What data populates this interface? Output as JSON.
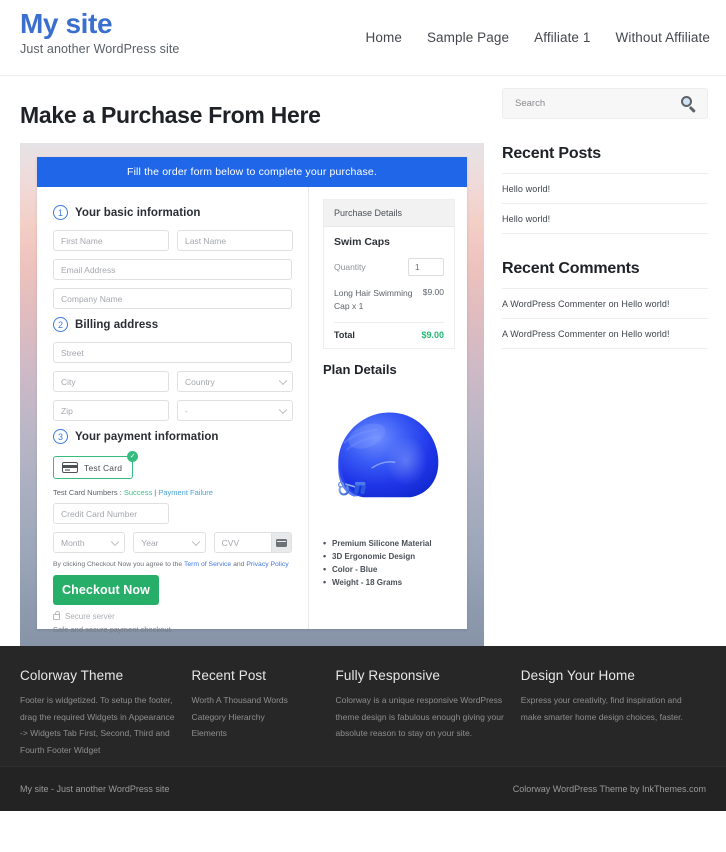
{
  "header": {
    "site_title": "My site",
    "tagline": "Just another WordPress site",
    "nav": [
      {
        "label": "Home"
      },
      {
        "label": "Sample Page"
      },
      {
        "label": "Affiliate 1"
      },
      {
        "label": "Without Affiliate"
      }
    ]
  },
  "main": {
    "page_title": "Make a Purchase From Here",
    "form": {
      "banner": "Fill the order form below to complete your purchase.",
      "steps": [
        {
          "num": "1",
          "label": "Your basic information"
        },
        {
          "num": "2",
          "label": "Billing address"
        },
        {
          "num": "3",
          "label": "Your payment information"
        }
      ],
      "basic_fields": {
        "first_name": "First Name",
        "last_name": "Last Name",
        "email": "Email Address",
        "company": "Company Name"
      },
      "billing_fields": {
        "street": "Street",
        "city": "City",
        "country": "Country",
        "zip": "Zip",
        "state": "-"
      },
      "payment": {
        "test_card_label": "Test  Card",
        "test_card_check": "✓",
        "test_numbers_prefix": "Test Card Numbers : ",
        "test_numbers_success": "Success",
        "test_numbers_sep": " | ",
        "test_numbers_failure": "Payment Failure",
        "card_number": "Credit Card Number",
        "month": "Month",
        "year": "Year",
        "cvv": "CVV",
        "terms_prefix": "By clicking Checkout Now you agree to the ",
        "terms_tos": "Term of Service",
        "terms_and": " and ",
        "terms_privacy": "Privacy Policy",
        "checkout_button": "Checkout Now",
        "secure_server": "Secure server",
        "safe_note": "Safe and secure payment checkout."
      }
    },
    "purchase_details": {
      "heading": "Purchase Details",
      "product": "Swim Caps",
      "quantity_label": "Quantity",
      "quantity_value": "1",
      "line_item_name": "Long Hair Swimming Cap x 1",
      "line_item_price": "$9.00",
      "total_label": "Total",
      "total_value": "$9.00",
      "total_color": "#23b873"
    },
    "plan_details": {
      "heading": "Plan Details",
      "features": [
        "Premium Silicone Material",
        "3D Ergonomic Design",
        "Color - Blue",
        "Weight  - 18 Grams"
      ]
    }
  },
  "sidebar": {
    "search_placeholder": "Search",
    "search_value": "",
    "recent_posts_title": "Recent Posts",
    "recent_posts": [
      {
        "label": "Hello world!"
      },
      {
        "label": "Hello world!"
      }
    ],
    "recent_comments_title": "Recent Comments",
    "recent_comments": [
      {
        "label": "A WordPress Commenter on Hello world!"
      },
      {
        "label": "A WordPress Commenter on Hello world!"
      }
    ]
  },
  "footer": {
    "widgets": [
      {
        "title": "Colorway Theme",
        "text": "Footer is widgetized. To setup the footer, drag the required Widgets in Appearance -> Widgets Tab First, Second, Third and Fourth Footer Widget"
      },
      {
        "title": "Recent Post",
        "links": [
          {
            "label": "Worth A Thousand Words"
          },
          {
            "label": "Category Hierarchy"
          },
          {
            "label": "Elements"
          }
        ]
      },
      {
        "title": "Fully Responsive",
        "text": "Colorway is a unique responsive WordPress theme design is fabulous enough giving your absolute reason to stay on your site."
      },
      {
        "title": "Design Your Home",
        "text": "Express your creativity, find inspiration and make smarter home design choices, faster."
      }
    ],
    "bottom_left": "My site - Just another WordPress site",
    "bottom_right": "Colorway WordPress Theme by InkThemes.com"
  }
}
